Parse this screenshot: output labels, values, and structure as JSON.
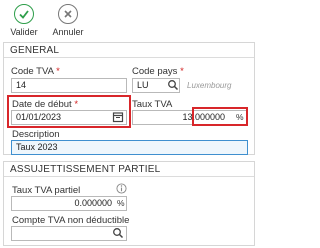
{
  "toolbar": {
    "validate_label": "Valider",
    "cancel_label": "Annuler",
    "validate_color": "#2e9e4a"
  },
  "general": {
    "title": "GENERAL",
    "code_tva_label": "Code TVA",
    "code_tva_value": "14",
    "code_pays_label": "Code pays",
    "code_pays_value": "LU",
    "code_pays_hint": "Luxembourg",
    "date_debut_label": "Date de début",
    "date_debut_value": "01/01/2023",
    "taux_tva_label": "Taux TVA",
    "taux_tva_value": "13.000000",
    "taux_tva_unit": "%",
    "description_label": "Description",
    "description_value": "Taux 2023",
    "required_mark": "*"
  },
  "partial": {
    "title": "ASSUJETTISSEMENT PARTIEL",
    "taux_partiel_label": "Taux TVA partiel",
    "taux_partiel_value": "0.000000",
    "taux_partiel_unit": "%",
    "compte_label": "Compte TVA non déductible",
    "compte_value": ""
  },
  "icons": {
    "validate": "check-circle-icon",
    "cancel": "x-circle-icon",
    "search": "search-icon",
    "calendar": "calendar-icon",
    "info": "info-icon"
  },
  "highlight_color": "#d8262a"
}
